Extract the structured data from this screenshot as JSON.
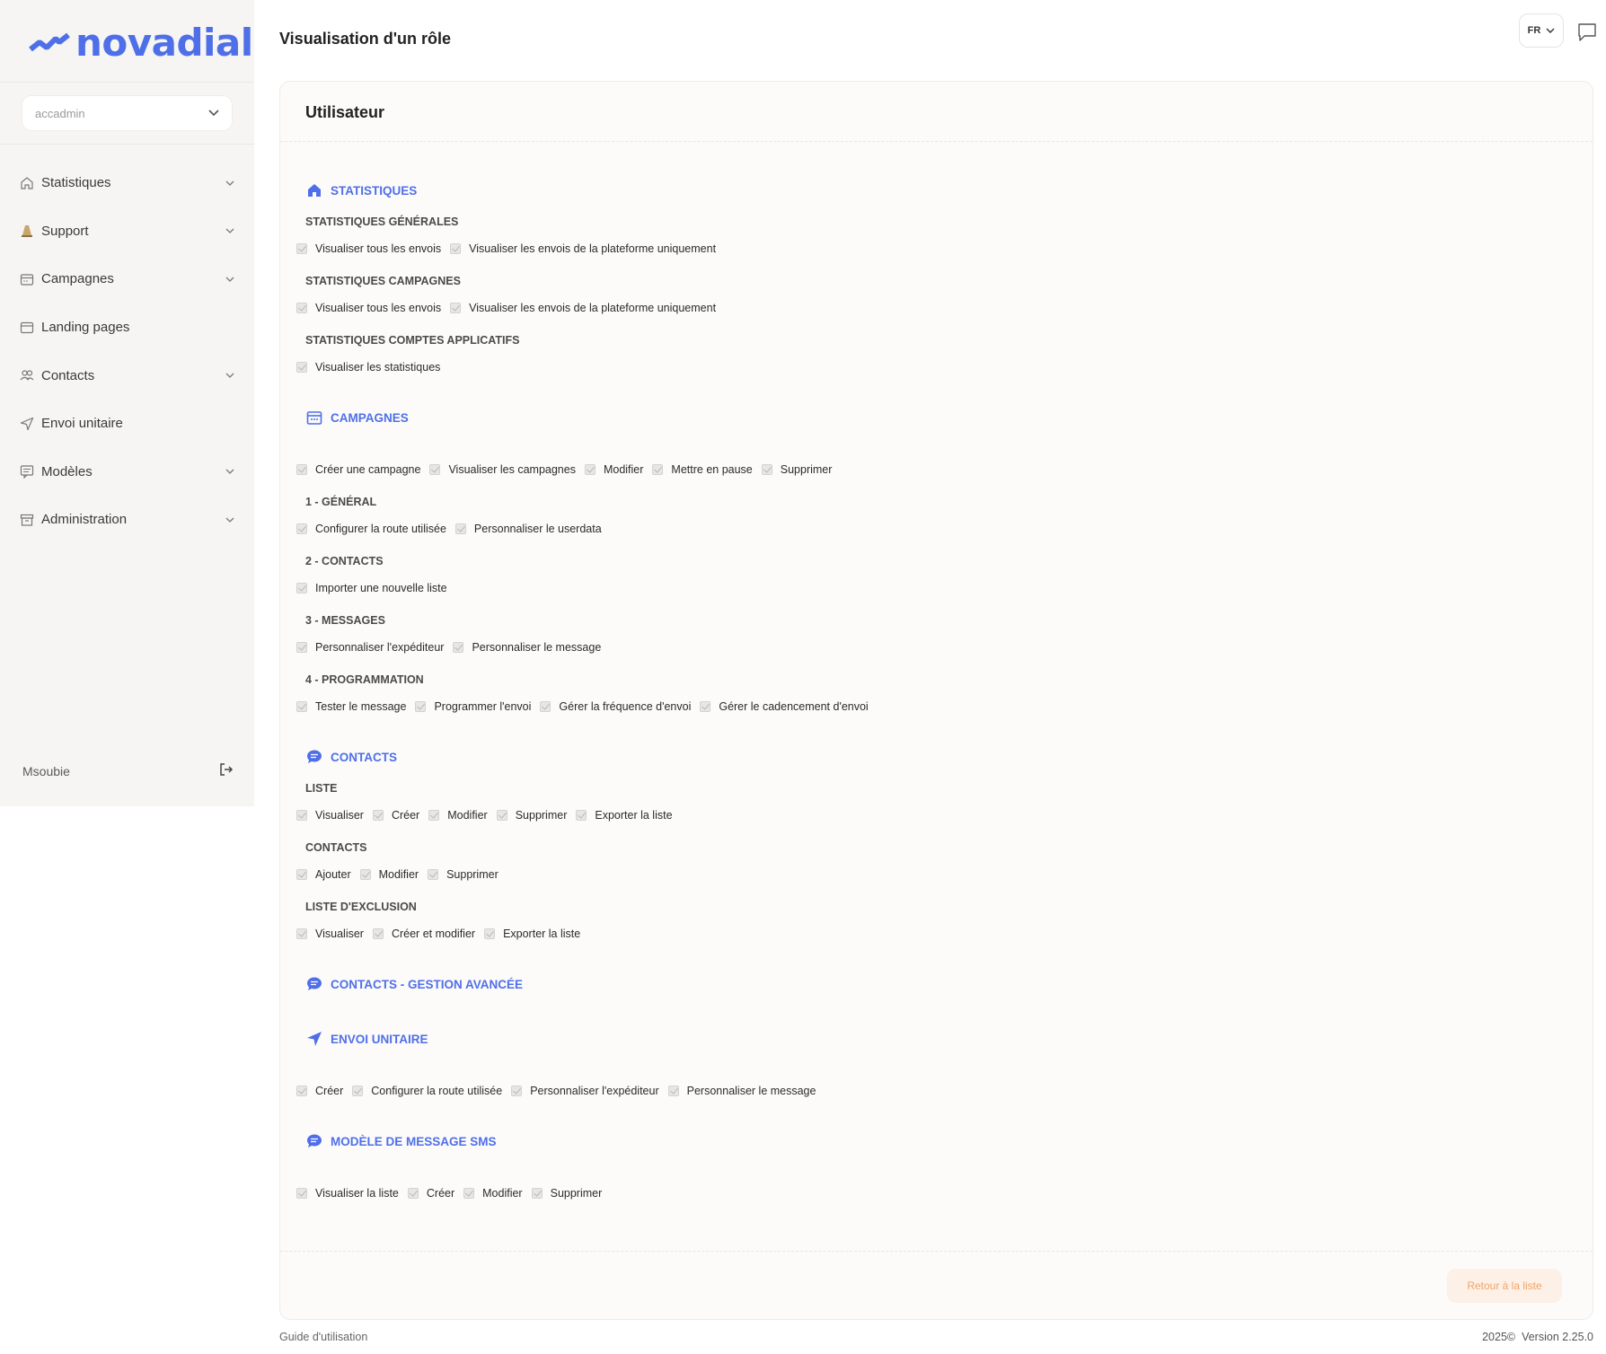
{
  "brand": {
    "name": "novadial",
    "color": "#4f6fe8"
  },
  "sidebar": {
    "account": "accadmin",
    "items": [
      {
        "label": "Statistiques",
        "icon": "home-icon",
        "expandable": true
      },
      {
        "label": "Support",
        "icon": "traffic-cone-icon",
        "expandable": true
      },
      {
        "label": "Campagnes",
        "icon": "calendar-icon",
        "expandable": true
      },
      {
        "label": "Landing pages",
        "icon": "browser-window-icon",
        "expandable": false
      },
      {
        "label": "Contacts",
        "icon": "users-icon",
        "expandable": true
      },
      {
        "label": "Envoi unitaire",
        "icon": "paper-plane-icon",
        "expandable": false
      },
      {
        "label": "Modèles",
        "icon": "message-template-icon",
        "expandable": true
      },
      {
        "label": "Administration",
        "icon": "archive-icon",
        "expandable": true
      }
    ],
    "user": "Msoubie"
  },
  "header": {
    "title": "Visualisation d'un rôle",
    "lang": "FR"
  },
  "card": {
    "title": "Utilisateur",
    "back_button": "Retour à la liste"
  },
  "sections": [
    {
      "title": "STATISTIQUES",
      "icon": "home-icon",
      "groups": [
        {
          "title": "STATISTIQUES GÉNÉRALES",
          "perms": [
            "Visualiser tous les envois",
            "Visualiser les envois de la plateforme uniquement"
          ]
        },
        {
          "title": "STATISTIQUES CAMPAGNES",
          "perms": [
            "Visualiser tous les envois",
            "Visualiser les envois de la plateforme uniquement"
          ]
        },
        {
          "title": "STATISTIQUES COMPTES APPLICATIFS",
          "perms": [
            "Visualiser les statistiques"
          ]
        }
      ]
    },
    {
      "title": "CAMPAGNES",
      "icon": "calendar-icon",
      "perms": [
        "Créer une campagne",
        "Visualiser les campagnes",
        "Modifier",
        "Mettre en pause",
        "Supprimer"
      ],
      "groups": [
        {
          "title": "1 - GÉNÉRAL",
          "perms": [
            "Configurer la route utilisée",
            "Personnaliser le userdata"
          ]
        },
        {
          "title": "2 - CONTACTS",
          "perms": [
            "Importer une nouvelle liste"
          ]
        },
        {
          "title": "3 - MESSAGES",
          "perms": [
            "Personnaliser l'expéditeur",
            "Personnaliser le message"
          ]
        },
        {
          "title": "4 - PROGRAMMATION",
          "perms": [
            "Tester le message",
            "Programmer l'envoi",
            "Gérer la fréquence d'envoi",
            "Gérer le cadencement d'envoi"
          ]
        }
      ]
    },
    {
      "title": "CONTACTS",
      "icon": "chat-bubble-icon",
      "groups": [
        {
          "title": "LISTE",
          "perms": [
            "Visualiser",
            "Créer",
            "Modifier",
            "Supprimer",
            "Exporter la liste"
          ]
        },
        {
          "title": "CONTACTS",
          "perms": [
            "Ajouter",
            "Modifier",
            "Supprimer"
          ]
        },
        {
          "title": "LISTE D'EXCLUSION",
          "perms": [
            "Visualiser",
            "Créer et modifier",
            "Exporter la liste"
          ]
        }
      ]
    },
    {
      "title": "CONTACTS - GESTION AVANCÉE",
      "icon": "chat-bubble-icon",
      "groups": []
    },
    {
      "title": "ENVOI UNITAIRE",
      "icon": "paper-plane-icon",
      "perms": [
        "Créer",
        "Configurer la route utilisée",
        "Personnaliser l'expéditeur",
        "Personnaliser le message"
      ],
      "groups": []
    },
    {
      "title": "MODÈLE DE MESSAGE SMS",
      "icon": "chat-bubble-icon",
      "perms": [
        "Visualiser la liste",
        "Créer",
        "Modifier",
        "Supprimer"
      ],
      "groups": []
    }
  ],
  "footer": {
    "guide": "Guide d'utilisation",
    "copyright": "2025©",
    "version": "Version 2.25.0"
  }
}
